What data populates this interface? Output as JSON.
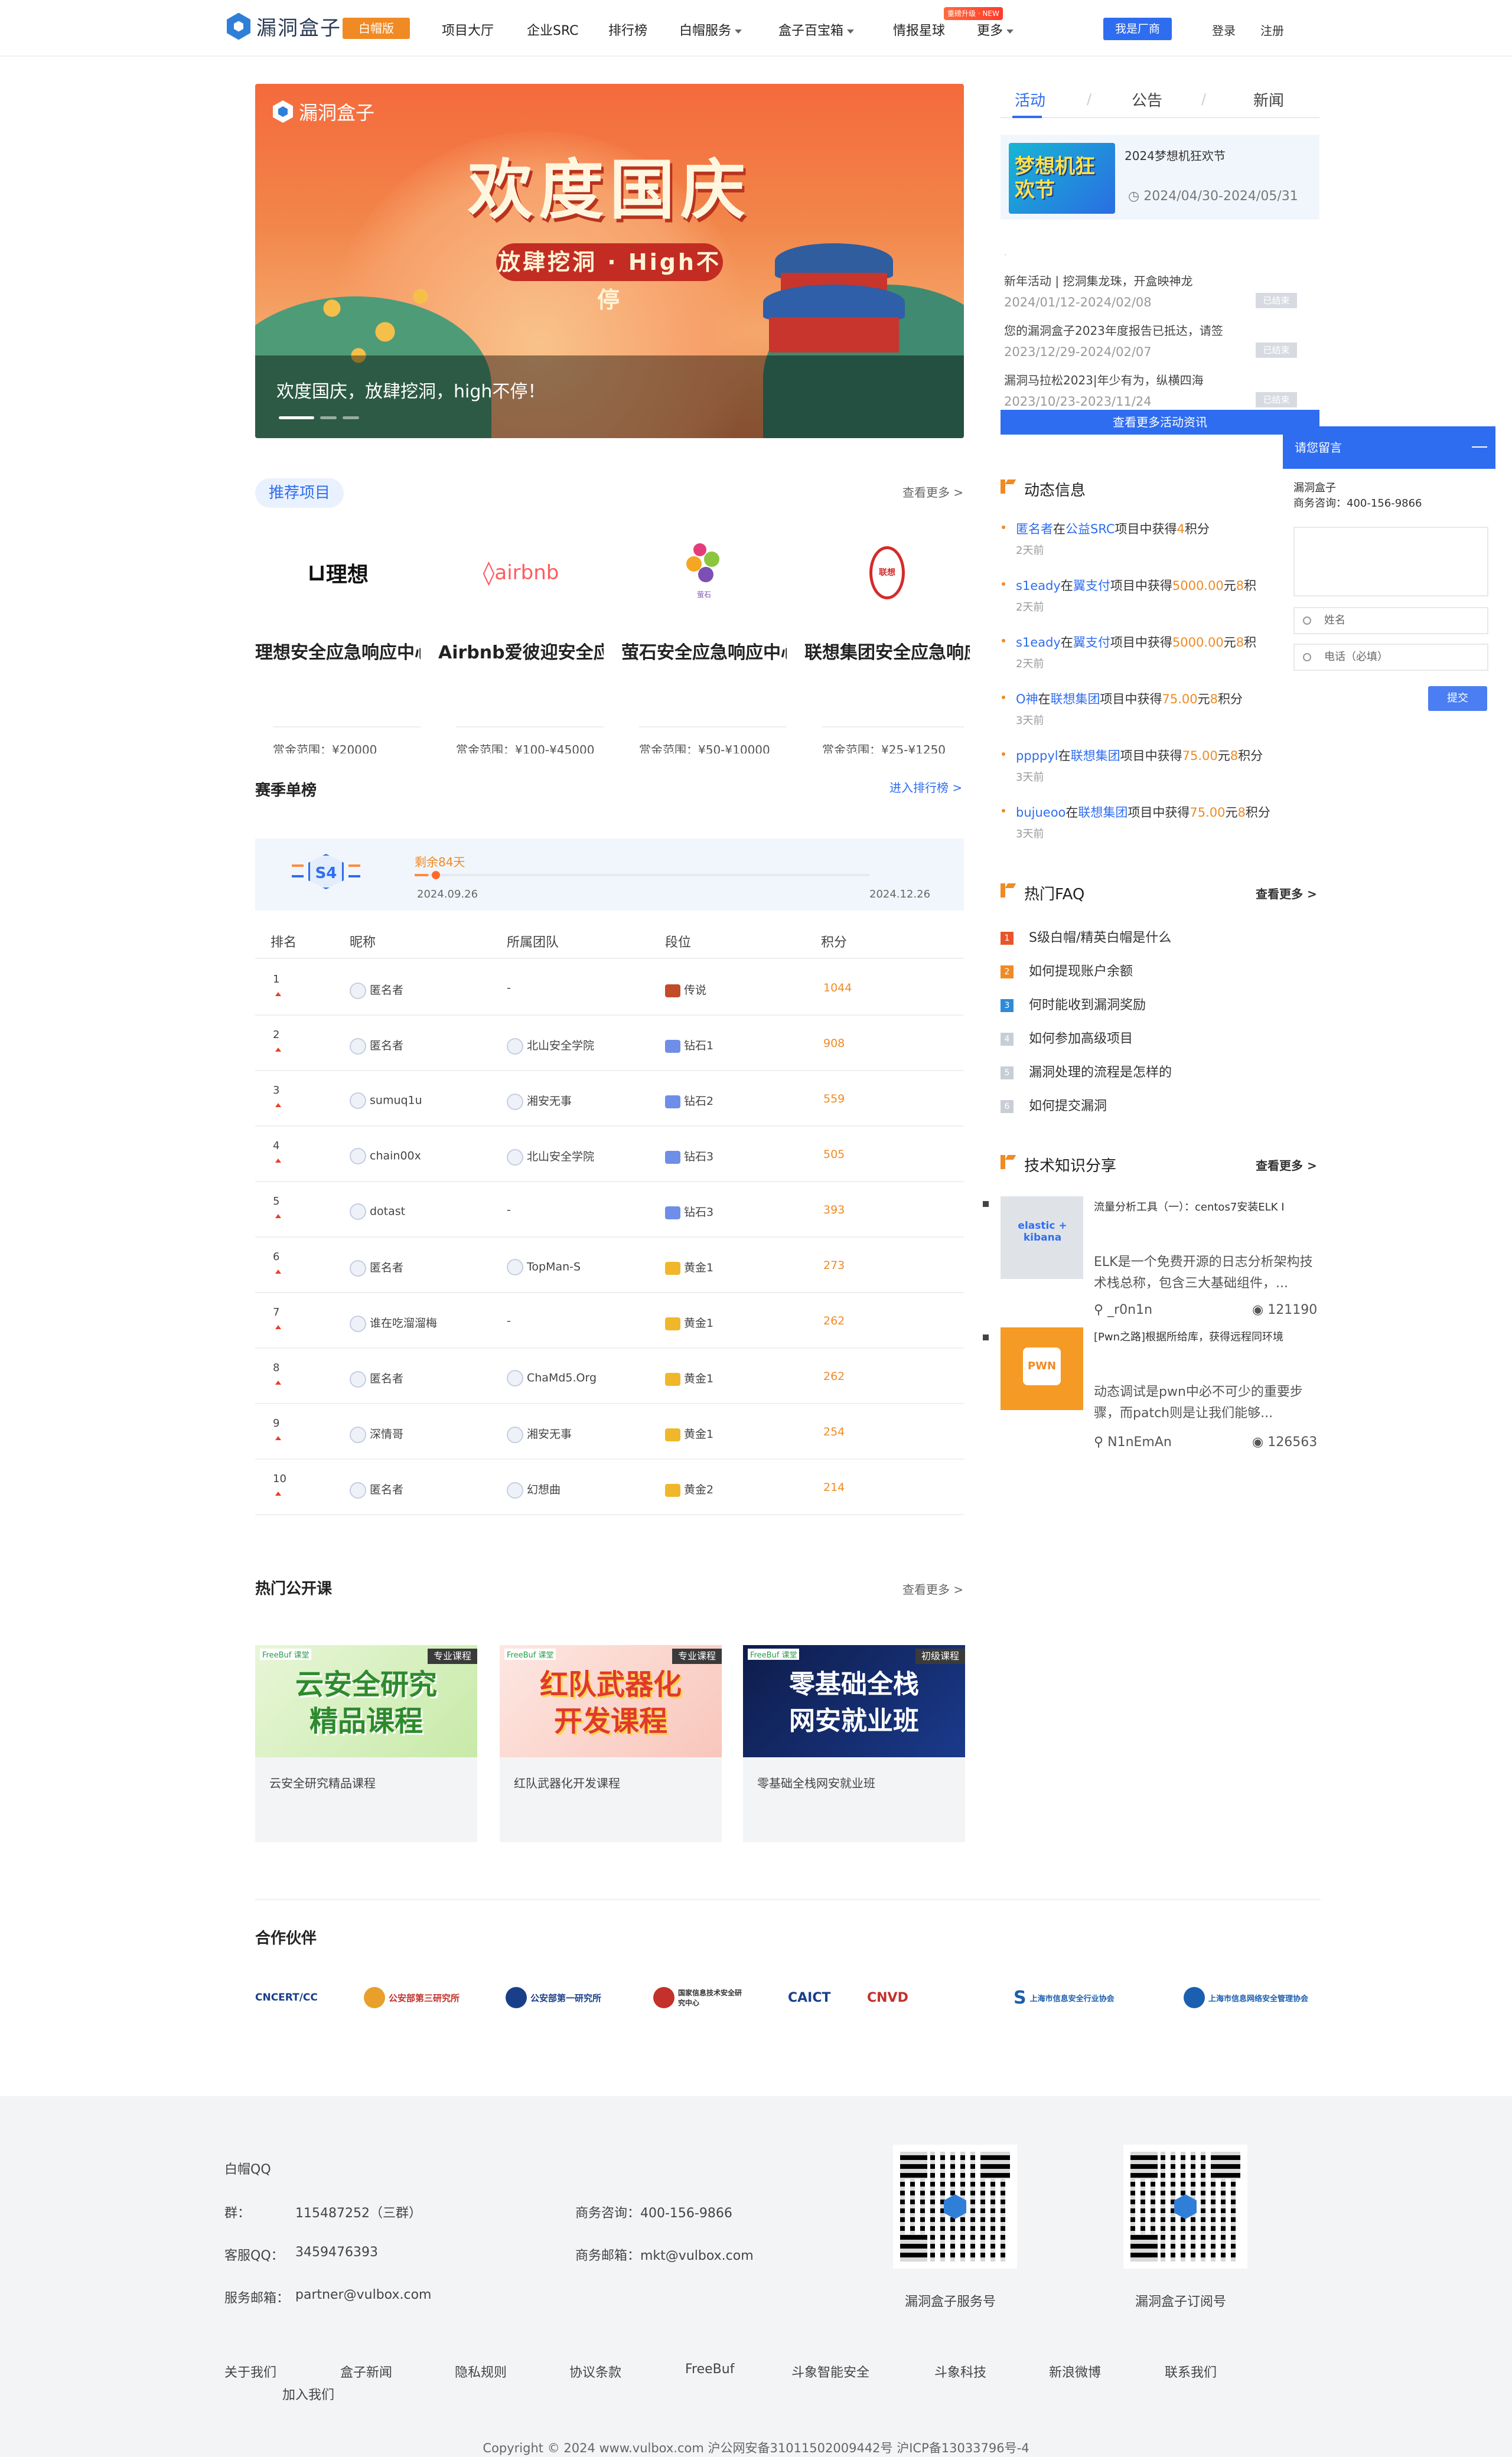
{
  "header": {
    "logo_text": "漏洞盒子",
    "edition": "白帽版",
    "nav": [
      "项目大厅",
      "企业SRC",
      "排行榜",
      "白帽服务",
      "盒子百宝箱",
      "情报星球",
      "更多"
    ],
    "new_tag": "重磅升级 · NEW",
    "vendor_button": "我是厂商",
    "login": "登录",
    "register": "注册"
  },
  "banner": {
    "logo": "漏洞盒子",
    "title": "欢度国庆",
    "subtitle": "放肆挖洞 · High不停",
    "caption": "欢度国庆，放肆挖洞，high不停！"
  },
  "right_tabs": {
    "tabs": [
      "活动",
      "公告",
      "新闻"
    ],
    "separator": "/",
    "featured": {
      "image_text": "梦想机狂欢节",
      "title": "2024梦想机狂欢节",
      "date": "2024/04/30-2024/05/31"
    },
    "small_dot": "·",
    "list": [
      {
        "title": "新年活动 | 挖洞集龙珠，开盒映神龙",
        "date": "2024/01/12-2024/02/08",
        "status": "已结束"
      },
      {
        "title": "您的漏洞盒子2023年度报告已抵达，请签",
        "date": "2023/12/29-2024/02/07",
        "status": "已结束"
      },
      {
        "title": "漏洞马拉松2023|年少有为，纵横四海",
        "date": "2023/10/23-2023/11/24",
        "status": "已结束"
      }
    ],
    "more_button": "查看更多活动资讯"
  },
  "recommended": {
    "tag": "推荐项目",
    "more": "查看更多 >",
    "projects": [
      {
        "logo": "理想",
        "title": "理想安全应急响应中心",
        "reward": "赏金范围：¥20000"
      },
      {
        "logo": "airbnb",
        "title": "Airbnb爱彼迎安全应急响应中心",
        "reward": "赏金范围：¥100-¥45000"
      },
      {
        "logo": "萤石",
        "title": "萤石安全应急响应中心",
        "reward": "赏金范围：¥50-¥10000"
      },
      {
        "logo": "联想",
        "title": "联想集团安全应急响应中心",
        "reward": "赏金范围：¥25-¥1250"
      }
    ]
  },
  "season": {
    "title": "赛季单榜",
    "more": "进入排行榜 >",
    "badge": "S4",
    "remaining": "剩余84天",
    "progress": 0.03,
    "start": "2024.09.26",
    "end": "2024.12.26",
    "columns": [
      "排名",
      "昵称",
      "所属团队",
      "段位",
      "积分"
    ],
    "rows": [
      {
        "rank": "1",
        "name": "匿名者",
        "team": "-",
        "tier": "传说",
        "score": "1044"
      },
      {
        "rank": "2",
        "name": "匿名者",
        "team": "北山安全学院",
        "tier": "钻石1",
        "score": "908"
      },
      {
        "rank": "3",
        "name": "sumuq1u",
        "team": "湘安无事",
        "tier": "钻石2",
        "score": "559"
      },
      {
        "rank": "4",
        "name": "chain00x",
        "team": "北山安全学院",
        "tier": "钻石3",
        "score": "505"
      },
      {
        "rank": "5",
        "name": "dotast",
        "team": "-",
        "tier": "钻石3",
        "score": "393"
      },
      {
        "rank": "6",
        "name": "匿名者",
        "team": "TopMan-S",
        "tier": "黄金1",
        "score": "273"
      },
      {
        "rank": "7",
        "name": "谁在吃溜溜梅",
        "team": "-",
        "tier": "黄金1",
        "score": "262"
      },
      {
        "rank": "8",
        "name": "匿名者",
        "team": "ChaMd5.Org",
        "tier": "黄金1",
        "score": "262"
      },
      {
        "rank": "9",
        "name": "深情哥",
        "team": "湘安无事",
        "tier": "黄金1",
        "score": "254"
      },
      {
        "rank": "10",
        "name": "匿名者",
        "team": "幻想曲",
        "tier": "黄金2",
        "score": "214"
      }
    ]
  },
  "courses": {
    "title": "热门公开课",
    "more": "查看更多 >",
    "brand": "FreeBuf 课堂",
    "items": [
      {
        "image_text": "云安全研究\n精品课程",
        "tag": "专业课程",
        "name": "云安全研究精品课程"
      },
      {
        "image_text": "红队武器化\n开发课程",
        "tag": "专业课程",
        "name": "红队武器化开发课程"
      },
      {
        "image_text": "零基础全栈\n网安就业班",
        "tag": "初级课程",
        "name": "零基础全栈网安就业班"
      }
    ]
  },
  "partners": {
    "title": "合作伙伴",
    "items": [
      "CNCERT/CC",
      "公安部第三研究所",
      "公安部第一研究所",
      "国家信息技术安全研究中心",
      "CAICT",
      "CNVD",
      "上海市信息安全行业协会",
      "上海市信息网络安全管理协会"
    ]
  },
  "dynamic": {
    "title": "动态信息",
    "items": [
      {
        "user": "匿名者",
        "mid": "在",
        "company": "公益SRC",
        "act": "项目中获得",
        "points": "4",
        "unit": "积分",
        "amount": "",
        "yuan": "",
        "time": "2天前"
      },
      {
        "user": "s1eady",
        "mid": "在",
        "company": "翼支付",
        "act": "项目中获得",
        "amount": "5000.00",
        "yuan": "元",
        "points": "8",
        "unit": "积",
        "time": "2天前"
      },
      {
        "user": "s1eady",
        "mid": "在",
        "company": "翼支付",
        "act": "项目中获得",
        "amount": "5000.00",
        "yuan": "元",
        "points": "8",
        "unit": "积",
        "time": "2天前"
      },
      {
        "user": "O神",
        "mid": "在",
        "company": "联想集团",
        "act": "项目中获得",
        "amount": "75.00",
        "yuan": "元",
        "points": "8",
        "unit": "积分",
        "time": "3天前"
      },
      {
        "user": "ppppyl",
        "mid": "在",
        "company": "联想集团",
        "act": "项目中获得",
        "amount": "75.00",
        "yuan": "元",
        "points": "8",
        "unit": "积分",
        "time": "3天前"
      },
      {
        "user": "bujueoo",
        "mid": "在",
        "company": "联想集团",
        "act": "项目中获得",
        "amount": "75.00",
        "yuan": "元",
        "points": "8",
        "unit": "积分",
        "time": "3天前"
      }
    ]
  },
  "faq": {
    "title": "热门FAQ",
    "more": "查看更多 >",
    "items": [
      "S级白帽/精英白帽是什么",
      "如何提现账户余额",
      "何时能收到漏洞奖励",
      "如何参加高级项目",
      "漏洞处理的流程是怎样的",
      "如何提交漏洞"
    ]
  },
  "tech": {
    "title": "技术知识分享",
    "more": "查看更多 >",
    "items": [
      {
        "image_text": "elastic + kibana",
        "title": "流量分析工具（一）：centos7安装ELK I",
        "desc": "ELK是一个免费开源的日志分析架构技术栈总称，包含三大基础组件，...",
        "author": "_r0n1n",
        "views": "121190"
      },
      {
        "image_text": "PWN",
        "title": "[Pwn之路]根据所给库，获得远程同环境",
        "desc": "动态调试是pwn中必不可少的重要步骤，而patch则是让我们能够...",
        "author": "N1nEmAn",
        "views": "126563"
      }
    ]
  },
  "message": {
    "title": "请您留言",
    "company": "漏洞盒子",
    "phone": "商务咨询：400-156-9866",
    "name_placeholder": "姓名",
    "phone_placeholder": "电话（必填）",
    "submit": "提交"
  },
  "footer": {
    "qq_title": "白帽QQ",
    "group_label": "群：",
    "group_value": "115487252（三群）",
    "cs_label": "客服QQ：",
    "cs_value": "3459476393",
    "email_label": "服务邮箱：",
    "email_value": "partner@vulbox.com",
    "biz_phone": "商务咨询：400-156-9866",
    "biz_email": "商务邮箱：mkt@vulbox.com",
    "qr1": "漏洞盒子服务号",
    "qr2": "漏洞盒子订阅号",
    "links": [
      "关于我们",
      "盒子新闻",
      "隐私规则",
      "协议条款",
      "FreeBuf",
      "斗象智能安全",
      "斗象科技",
      "新浪微博",
      "联系我们"
    ],
    "join": "加入我们",
    "copyright": "Copyright © 2024 www.vulbox.com  沪公网安备31011502009442号  沪ICP备13033796号-4"
  }
}
